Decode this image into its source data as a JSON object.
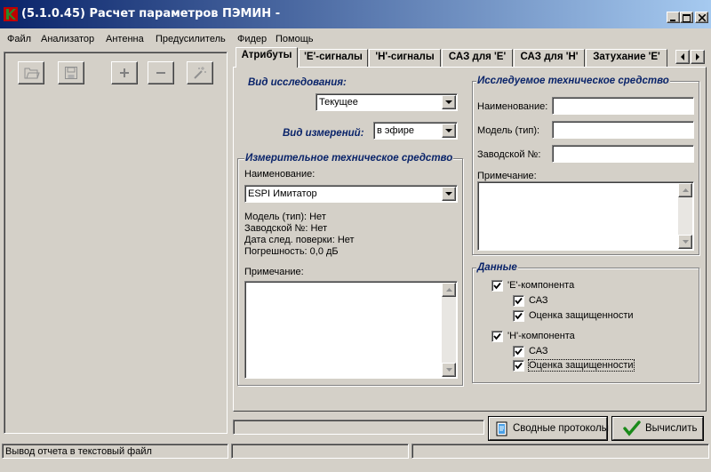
{
  "window": {
    "title": "(5.1.0.45) Расчет параметров ПЭМИН -"
  },
  "menu": [
    "Файл",
    "Анализатор",
    "Антенна",
    "Предусилитель",
    "Фидер",
    "Помощь"
  ],
  "toolbar": {
    "icons": [
      "open-folder-icon",
      "save-icon",
      "plus-icon",
      "minus-icon",
      "wizard-icon"
    ]
  },
  "tabs": [
    "Атрибуты",
    "'E'-сигналы",
    "'H'-сигналы",
    "САЗ для 'E'",
    "САЗ для 'H'",
    "Затухание 'E'"
  ],
  "research": {
    "type_label": "Вид исследования:",
    "type_value": "Текущее",
    "measure_label": "Вид измерений:",
    "measure_value": "в эфире"
  },
  "measuring_device": {
    "title": "Измерительное техническое средство",
    "name_label": "Наименование:",
    "name_value": "ESPI Имитатор",
    "info": [
      "Модель (тип): Нет",
      "Заводской №: Нет",
      "Дата след. поверки: Нет",
      "Погрешность: 0,0 дБ"
    ],
    "note_label": "Примечание:"
  },
  "examined_device": {
    "title": "Исследуемое техническое средство",
    "name_label": "Наименование:",
    "model_label": "Модель (тип):",
    "serial_label": "Заводской №:",
    "note_label": "Примечание:",
    "name_value": "",
    "model_value": "",
    "serial_value": ""
  },
  "data_group": {
    "title": "Данные",
    "e_component": "'E'-компонента",
    "e_saz": "САЗ",
    "e_protection": "Оценка защищенности",
    "h_component": "'H'-компонента",
    "h_saz": "САЗ",
    "h_protection": "Оценка защищенности",
    "checked": true
  },
  "buttons": {
    "summary": "Сводные протоколы",
    "calculate": "Вычислить"
  },
  "status": {
    "text": "Вывод отчета в текстовый файл"
  },
  "colors": {
    "title_start": "#0a246a",
    "title_end": "#a6caf0",
    "group_title": "#0a246a",
    "face": "#d4d0c8",
    "check_ok": "#1a8a1a"
  }
}
